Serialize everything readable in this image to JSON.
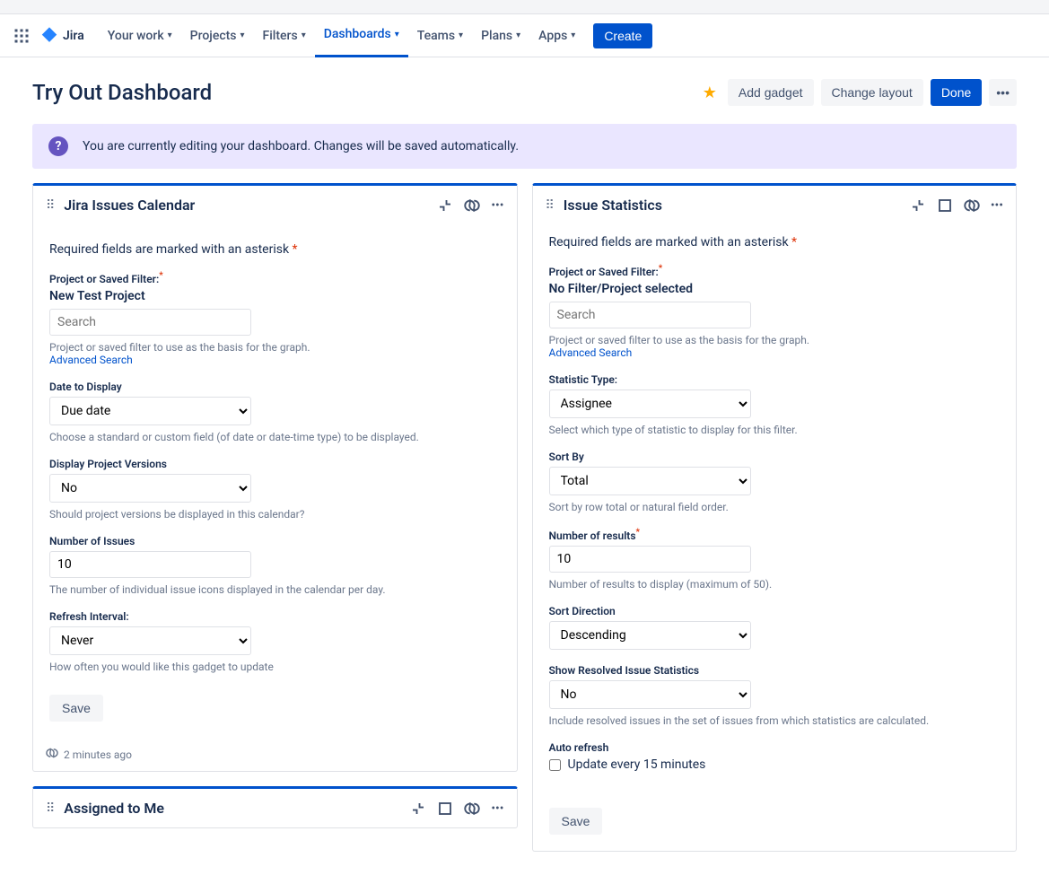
{
  "nav": {
    "logo_text": "Jira",
    "items": [
      "Your work",
      "Projects",
      "Filters",
      "Dashboards",
      "Teams",
      "Plans",
      "Apps"
    ],
    "active_index": 3,
    "create": "Create"
  },
  "header": {
    "title": "Try Out Dashboard",
    "add_gadget": "Add gadget",
    "change_layout": "Change layout",
    "done": "Done"
  },
  "banner": {
    "text": "You are currently editing your dashboard. Changes will be saved automatically."
  },
  "gadget1": {
    "title": "Jira Issues Calendar",
    "required_note": "Required fields are marked with an asterisk",
    "project_label": "Project or Saved Filter:",
    "project_value": "New Test Project",
    "search_placeholder": "Search",
    "project_help": "Project or saved filter to use as the basis for the graph.",
    "advanced_search": "Advanced Search",
    "date_label": "Date to Display",
    "date_value": "Due date",
    "date_help": "Choose a standard or custom field (of date or date-time type) to be displayed.",
    "versions_label": "Display Project Versions",
    "versions_value": "No",
    "versions_help": "Should project versions be displayed in this calendar?",
    "num_issues_label": "Number of Issues",
    "num_issues_value": "10",
    "num_issues_help": "The number of individual issue icons displayed in the calendar per day.",
    "refresh_label": "Refresh Interval:",
    "refresh_value": "Never",
    "refresh_help": "How often you would like this gadget to update",
    "save": "Save",
    "footer_time": "2 minutes ago"
  },
  "gadget2": {
    "title": "Issue Statistics",
    "required_note": "Required fields are marked with an asterisk",
    "project_label": "Project or Saved Filter:",
    "project_value": "No Filter/Project selected",
    "search_placeholder": "Search",
    "project_help": "Project or saved filter to use as the basis for the graph.",
    "advanced_search": "Advanced Search",
    "stat_type_label": "Statistic Type:",
    "stat_type_value": "Assignee",
    "stat_type_help": "Select which type of statistic to display for this filter.",
    "sort_by_label": "Sort By",
    "sort_by_value": "Total",
    "sort_by_help": "Sort by row total or natural field order.",
    "num_results_label": "Number of results",
    "num_results_value": "10",
    "num_results_help": "Number of results to display (maximum of 50).",
    "sort_dir_label": "Sort Direction",
    "sort_dir_value": "Descending",
    "resolved_label": "Show Resolved Issue Statistics",
    "resolved_value": "No",
    "resolved_help": "Include resolved issues in the set of issues from which statistics are calculated.",
    "auto_refresh_label": "Auto refresh",
    "auto_refresh_checkbox": "Update every 15 minutes",
    "save": "Save"
  },
  "gadget3": {
    "title": "Assigned to Me"
  }
}
